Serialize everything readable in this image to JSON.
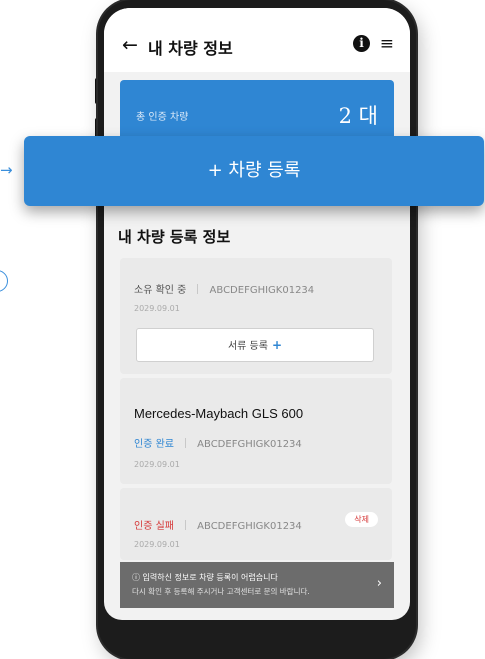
{
  "header": {
    "back_symbol": "←",
    "title": "내 차량 정보"
  },
  "summary": {
    "label": "총 인증 차량",
    "value": "2 대"
  },
  "add_button": {
    "label": "+  차량 등록"
  },
  "section": {
    "title": "내 차량 등록 정보"
  },
  "cards": [
    {
      "status": "소유 확인 중",
      "code": "ABCDEFGHIGK01234",
      "date": "2029.09.01",
      "doc_button": "서류 등록",
      "doc_plus": "+"
    },
    {
      "model": "Mercedes-Maybach GLS 600",
      "status": "인증 완료",
      "code": "ABCDEFGHIGK01234",
      "date": "2029.09.01"
    },
    {
      "status": "인증 실패",
      "code": "ABCDEFGHIGK01234",
      "date": "2029.09.01",
      "delete_label": "삭제"
    }
  ],
  "error_banner": {
    "line1": "ⓘ 입력하신 정보로 차량 등록이 어렵습니다",
    "line2": "다시 확인 후 등록해 주시거나 고객센터로 문의 바랍니다.",
    "chevron": "›"
  },
  "icons": {
    "info": "info-icon",
    "menu": "hamburger-menu-icon",
    "back": "back-arrow-icon",
    "side_arrow": "arrow-right-icon"
  },
  "colors": {
    "accent": "#2f86d3",
    "error": "#d63a3a",
    "screen_bg": "#f2f2f2",
    "banner_bg": "#6c6c6c"
  }
}
